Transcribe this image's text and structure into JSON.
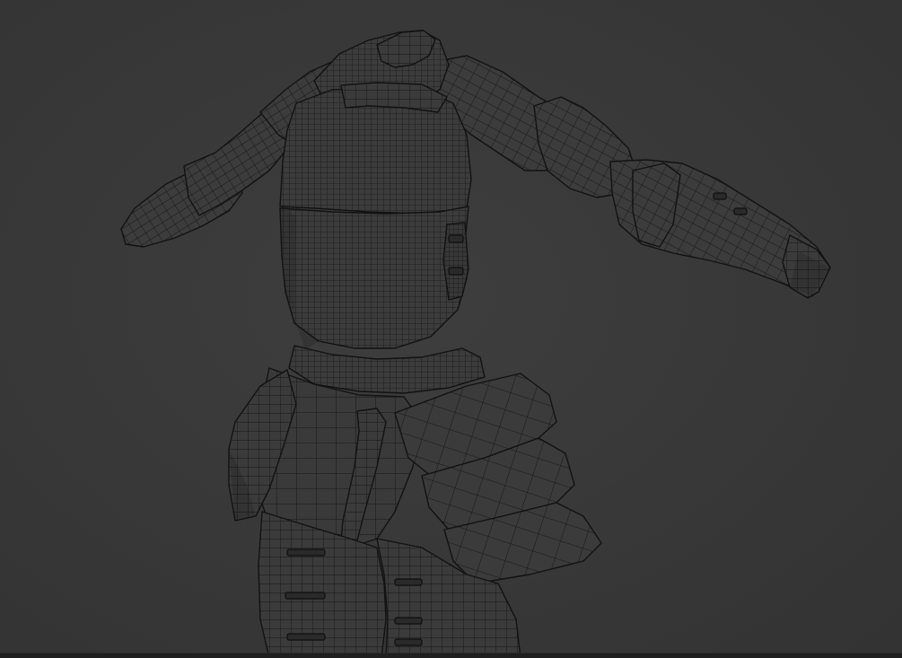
{
  "viewport": {
    "background_color": "#3a3a3a",
    "mesh_fill_color": "#3b3b3b",
    "mesh_shadow_color": "#323232",
    "wire_color": "#141414",
    "shading": "wireframe-on-solid",
    "subject": "armor-mesh"
  }
}
